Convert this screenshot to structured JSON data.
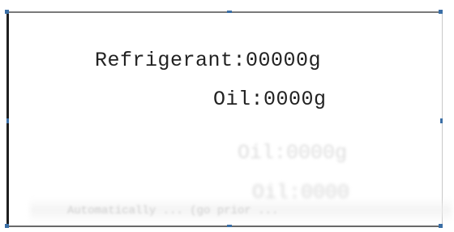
{
  "readouts": {
    "refrigerant": "Refrigerant:00000g",
    "oil": "Oil:0000g"
  },
  "ghosting": {
    "oil_echo_1": "Oil:0000g",
    "oil_echo_2": "Oil:0000",
    "hint_text": "Automatically ... (go prior ..."
  },
  "colors": {
    "text": "#222222",
    "corner_marker": "#3a6ea5",
    "background": "#ffffff"
  }
}
